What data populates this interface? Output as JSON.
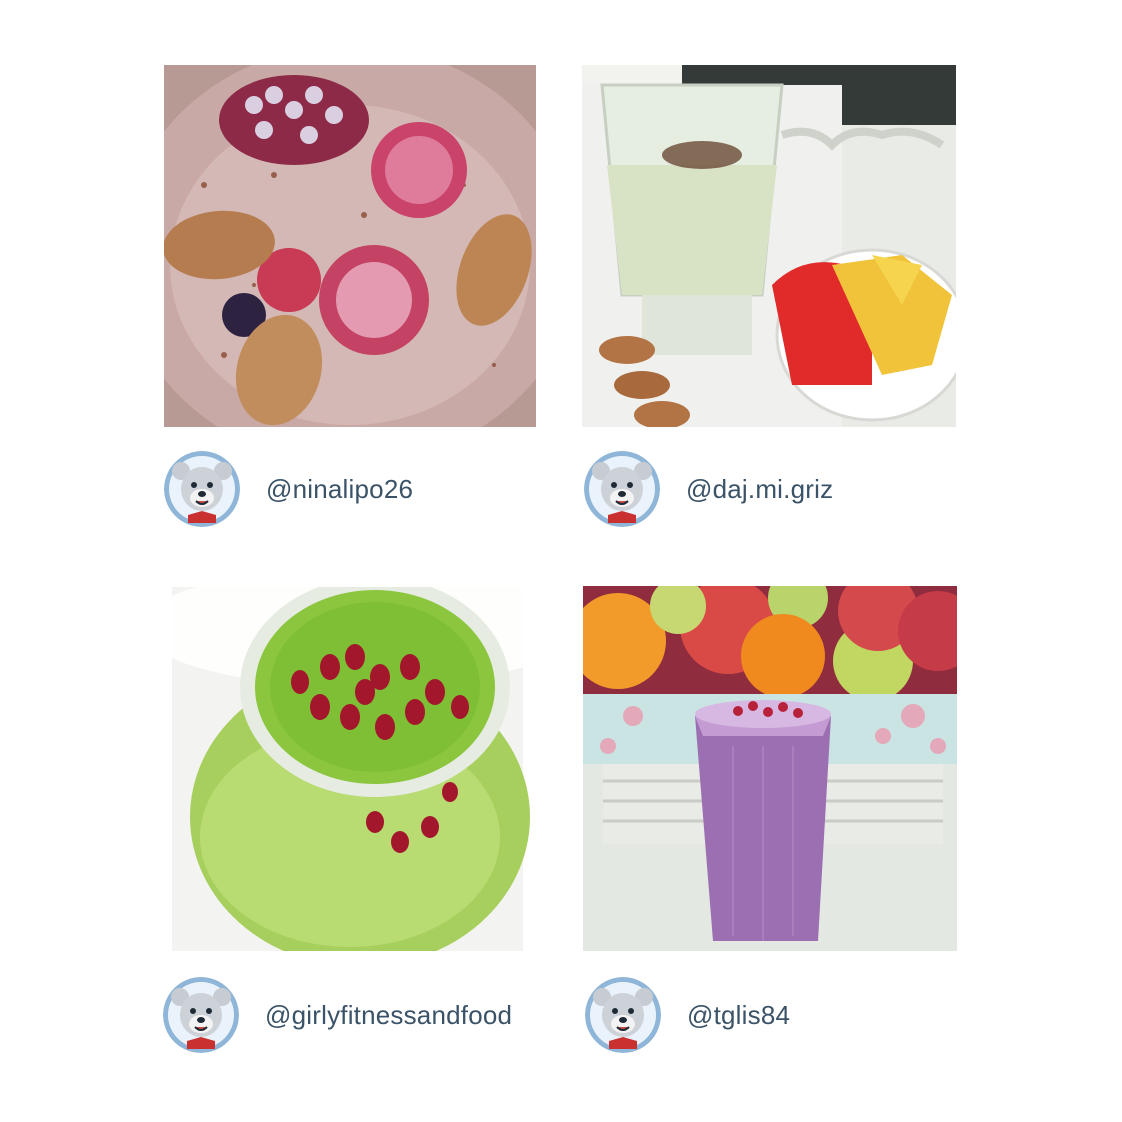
{
  "posts": [
    {
      "handle": "@ninalipo26",
      "photo_icon": "berry-almond-smoothie-photo",
      "avatar_icon": "bear-mascot-avatar"
    },
    {
      "handle": "@daj.mi.griz",
      "photo_icon": "kiwi-smoothie-fruit-bowl-photo",
      "avatar_icon": "bear-mascot-avatar"
    },
    {
      "handle": "@girlyfitnessandfood",
      "photo_icon": "green-smoothie-pomegranate-photo",
      "avatar_icon": "bear-mascot-avatar"
    },
    {
      "handle": "@tglis84",
      "photo_icon": "purple-smoothie-fruit-basket-photo",
      "avatar_icon": "bear-mascot-avatar"
    }
  ],
  "colors": {
    "handle_text": "#3b5368",
    "avatar_ring": "#8fb6d8",
    "background": "#ffffff"
  }
}
